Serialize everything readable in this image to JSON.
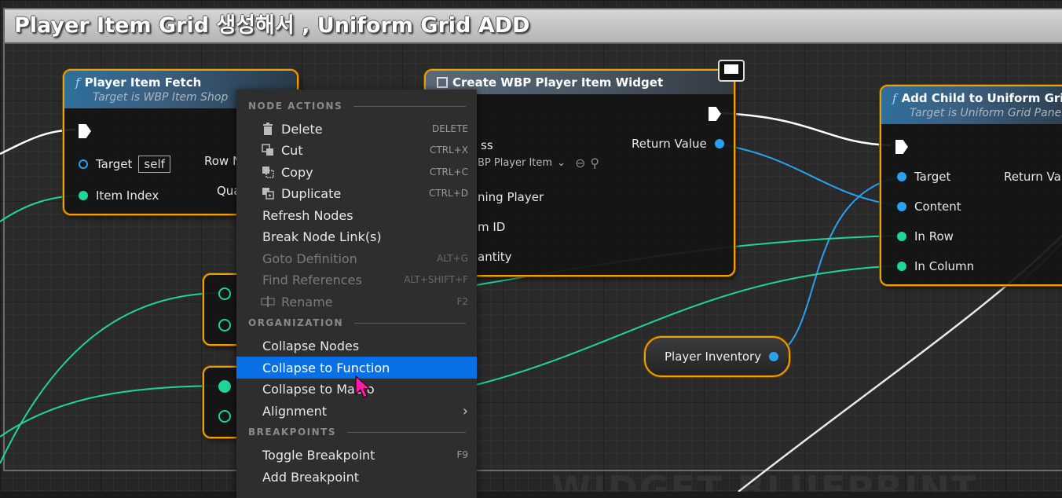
{
  "comment": {
    "title": "Player Item Grid 생성해서 , Uniform Grid ADD"
  },
  "watermark": "WIDGET BLUEPRINT",
  "nodes": {
    "fetch": {
      "title": "Player Item Fetch",
      "subtitle": "Target is WBP Item Shop",
      "target_label": "Target",
      "target_value": "self",
      "item_index_label": "Item Index",
      "row_label": "Row N",
      "quantity_label": "Qua"
    },
    "create_widget": {
      "title": "Create WBP Player Item Widget",
      "class_label": "ss",
      "class_value": "BP Player Item",
      "return_label": "Return Value",
      "owning_label": "ning Player",
      "item_id_label": "m ID",
      "quantity_label": "antity"
    },
    "add_child": {
      "title": "Add Child to Uniform Grid",
      "subtitle": "Target is Uniform Grid Panel",
      "target_label": "Target",
      "return_label": "Return Value",
      "content_label": "Content",
      "in_row_label": "In Row",
      "in_column_label": "In Column"
    },
    "player_inventory": {
      "label": "Player Inventory"
    }
  },
  "context_menu": {
    "sections": {
      "node_actions": "NODE ACTIONS",
      "organization": "ORGANIZATION",
      "breakpoints": "BREAKPOINTS"
    },
    "items": {
      "delete": {
        "label": "Delete",
        "shortcut": "DELETE"
      },
      "cut": {
        "label": "Cut",
        "shortcut": "CTRL+X"
      },
      "copy": {
        "label": "Copy",
        "shortcut": "CTRL+C"
      },
      "duplicate": {
        "label": "Duplicate",
        "shortcut": "CTRL+D"
      },
      "refresh_nodes": {
        "label": "Refresh Nodes"
      },
      "break_links": {
        "label": "Break Node Link(s)"
      },
      "goto_definition": {
        "label": "Goto Definition",
        "shortcut": "ALT+G"
      },
      "find_references": {
        "label": "Find References",
        "shortcut": "ALT+SHIFT+F"
      },
      "rename": {
        "label": "Rename",
        "shortcut": "F2"
      },
      "collapse_nodes": {
        "label": "Collapse Nodes"
      },
      "collapse_to_function": {
        "label": "Collapse to Function"
      },
      "collapse_to_macro": {
        "label": "Collapse to Macro"
      },
      "alignment": {
        "label": "Alignment"
      },
      "toggle_breakpoint": {
        "label": "Toggle Breakpoint",
        "shortcut": "F9"
      },
      "add_breakpoint": {
        "label": "Add Breakpoint"
      }
    }
  },
  "colors": {
    "node_border": "#f0a000",
    "object_pin": "#2aa0f0",
    "int_pin": "#1ed59a",
    "menu_highlight": "#0a70e6"
  }
}
